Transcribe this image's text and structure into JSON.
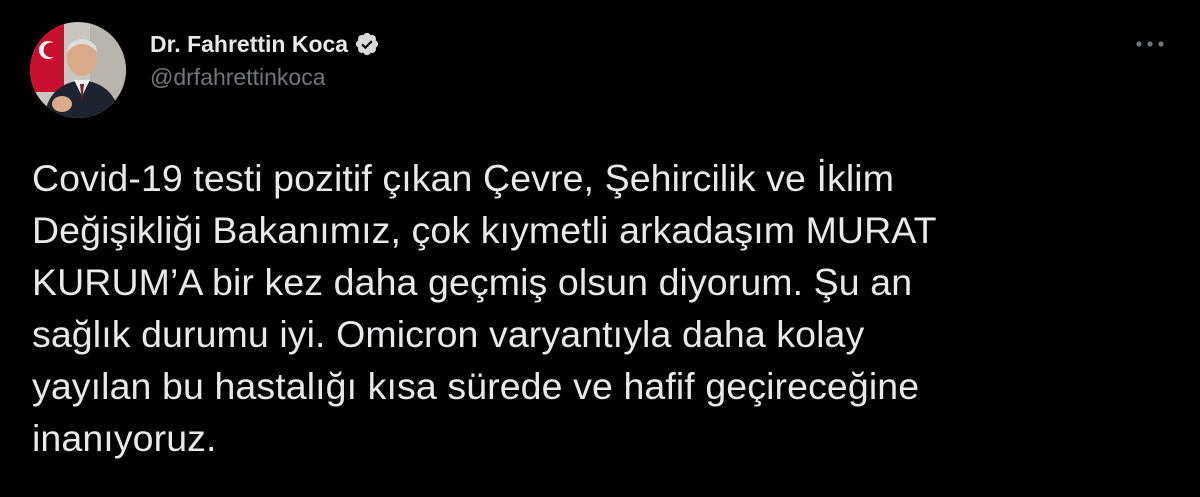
{
  "author": {
    "display_name": "Dr. Fahrettin Koca",
    "handle": "@drfahrettinkoca",
    "verified": true
  },
  "tweet": {
    "text": "Covid-19 testi pozitif çıkan Çevre, Şehircilik ve İklim\nDeğişikliği Bakanımız, çok kıymetli arkadaşım MURAT\nKURUM’A bir kez daha geçmiş olsun diyorum. Şu an\nsağlık durumu iyi. Omicron varyantıyla daha kolay\nyayılan bu hastalığı kısa sürede ve hafif geçireceğine\ninanıyoruz."
  },
  "icons": {
    "verified": "verified-badge-icon",
    "more": "more-options-icon"
  },
  "colors": {
    "background": "#000000",
    "text_primary": "#e7e9ea",
    "text_secondary": "#71767b",
    "verified_badge": "#d9d9d9"
  }
}
